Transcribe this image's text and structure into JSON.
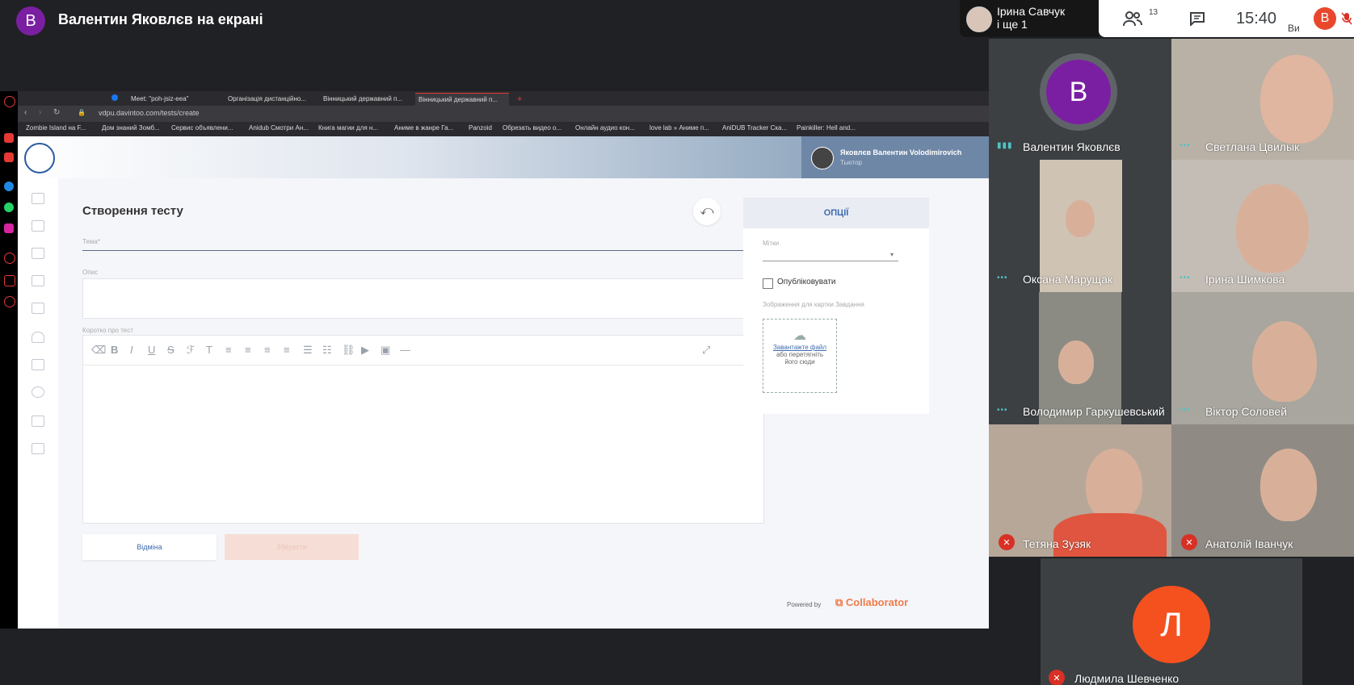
{
  "presenter": {
    "initial": "В",
    "title": "Валентин Яковлєв на екрані"
  },
  "pinned": {
    "name": "Ірина Савчук",
    "more": "і ще 1"
  },
  "top_panel": {
    "participants_count": "13",
    "time": "15:40",
    "me_initial": "В",
    "me_label": "Ви"
  },
  "browser": {
    "tabs": [
      {
        "label": "Meet: \"poh-jsiz-eea\""
      },
      {
        "label": "Організація дистанційно..."
      },
      {
        "label": "Вінницький державний п..."
      },
      {
        "label": "Вінницький державний п..."
      }
    ],
    "url": "vdpu.davintoo.com/tests/create",
    "bookmarks": [
      "Zombie Island на F...",
      "Дом знаний Зомб...",
      "Сервис объявлени...",
      "Anidub Смотри Ан...",
      "Книга магии для н...",
      "Аниме в жанре Га...",
      "Panzoid",
      "Обрезать видео о...",
      "Онлайн аудио кон...",
      "love lab » Аниме п...",
      "AniDUB Tracker Ска...",
      "Painkiller: Hell and..."
    ]
  },
  "site": {
    "user_name": "Яковлєв Валентин Volodimirovich",
    "user_role": "Тьютор",
    "page_title": "Створення тесту",
    "topic_label": "Тема*",
    "description_label": "Опис",
    "about_label": "Коротко про тест",
    "cancel_label": "Відміна",
    "save_label": "Зберегти",
    "options": {
      "title": "ОПЦІЇ",
      "tags_label": "Мітки",
      "publish_label": "Опубліковувати",
      "image_label": "Зображення для картки Завдання",
      "upload_link": "Завантажте файл",
      "upload_hint": "або перетягніть його сюди"
    },
    "powered_by": "Powered by",
    "brand": "Collaborator"
  },
  "participants": [
    {
      "name": "Валентин Яковлєв",
      "initial": "В"
    },
    {
      "name": "Светлана Цвилык"
    },
    {
      "name": "Оксана Марущак"
    },
    {
      "name": "Ірина Шимкова"
    },
    {
      "name": "Володимир Гаркушевський"
    },
    {
      "name": "Віктор Соловей"
    },
    {
      "name": "Тетяна Зузяк"
    },
    {
      "name": "Анатолій Іванчук"
    },
    {
      "name": "Людмила Шевченко",
      "initial": "Л"
    }
  ],
  "colors": {
    "presenter_avatar": "#7b1fa2",
    "me_avatar": "#e8472c",
    "lyudmyla_avatar": "#f4511e",
    "accent": "#3e6bb0"
  }
}
